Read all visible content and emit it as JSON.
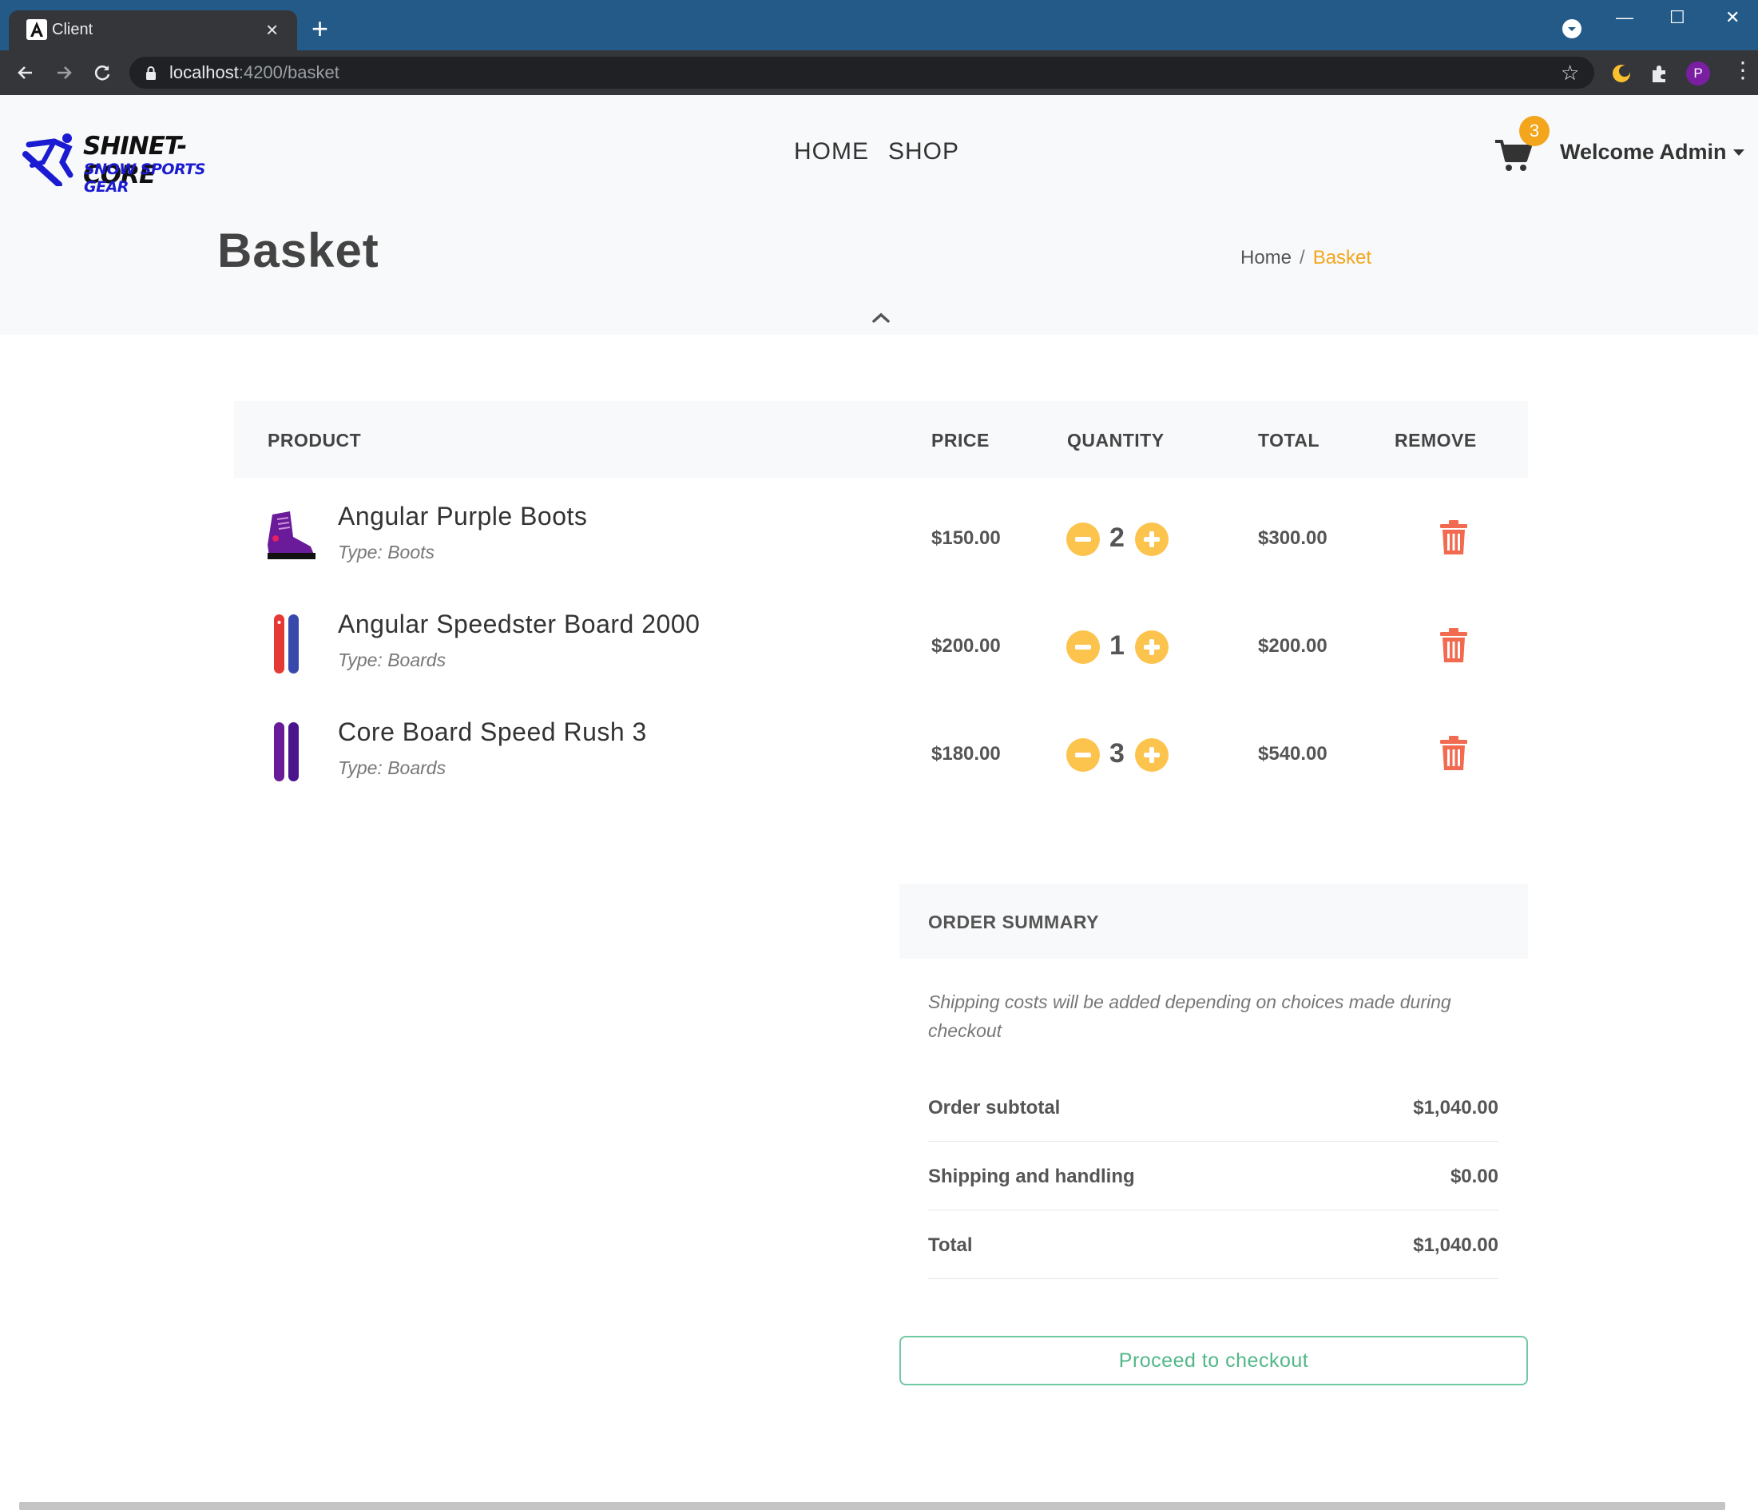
{
  "browser": {
    "tab_title": "Client",
    "tab_close": "×",
    "new_tab": "+",
    "url_host": "localhost",
    "url_path": ":4200/basket",
    "profile_initial": "P",
    "window_buttons": {
      "minimize": "—",
      "maximize": "☐",
      "close": "✕"
    },
    "star": "☆",
    "menu": "⋮"
  },
  "header": {
    "logo_line1": "SHINET-CORE",
    "logo_line2": "SNOW SPORTS GEAR",
    "nav": [
      "HOME",
      "SHOP"
    ],
    "cart_count": "3",
    "welcome": "Welcome Admin"
  },
  "page": {
    "title": "Basket",
    "breadcrumb": {
      "home": "Home",
      "separator": "/",
      "current": "Basket"
    }
  },
  "table": {
    "headers": {
      "product": "PRODUCT",
      "price": "PRICE",
      "quantity": "QUANTITY",
      "total": "TOTAL",
      "remove": "REMOVE"
    },
    "rows": [
      {
        "name": "Angular Purple Boots",
        "type": "Type: Boots",
        "price": "$150.00",
        "quantity": "2",
        "total": "$300.00",
        "image": "purple-boot-icon"
      },
      {
        "name": "Angular Speedster Board 2000",
        "type": "Type: Boards",
        "price": "$200.00",
        "quantity": "1",
        "total": "$200.00",
        "image": "red-blue-boards-icon"
      },
      {
        "name": "Core Board Speed Rush 3",
        "type": "Type: Boards",
        "price": "$180.00",
        "quantity": "3",
        "total": "$540.00",
        "image": "purple-boards-icon"
      }
    ]
  },
  "summary": {
    "title": "ORDER SUMMARY",
    "note": "Shipping costs will be added depending on choices made during checkout",
    "rows": [
      {
        "label": "Order subtotal",
        "value": "$1,040.00"
      },
      {
        "label": "Shipping and handling",
        "value": "$0.00"
      },
      {
        "label": "Total",
        "value": "$1,040.00"
      }
    ],
    "checkout_button": "Proceed to checkout"
  },
  "colors": {
    "chrome_tabbar": "#235a88",
    "accent_orange": "#f3a51c",
    "qty_button": "#fcc34d",
    "trash": "#f26a4f",
    "checkout_green": "#52b788"
  }
}
